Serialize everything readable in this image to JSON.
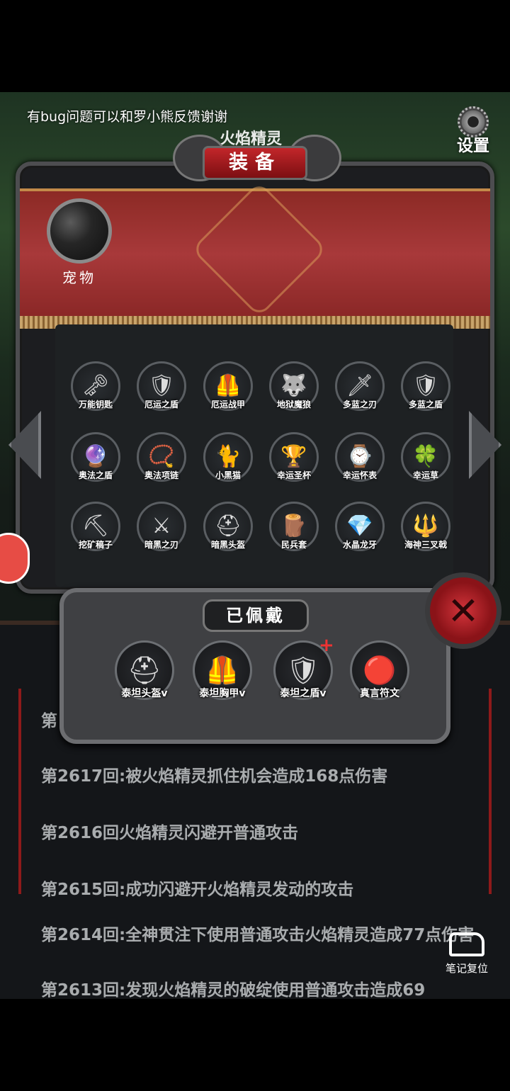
{
  "notice": "有bug问题可以和罗小熊反馈谢谢",
  "settings_label": "设置",
  "enemy_name": "火焰精灵",
  "panel_title": "装备",
  "pet_label": "宠物",
  "items": [
    {
      "name": "万能钥匙",
      "icon": "key-icon",
      "glyph": "🗝"
    },
    {
      "name": "厄运之盾",
      "icon": "red-shield-icon",
      "glyph": "🛡"
    },
    {
      "name": "厄运战甲",
      "icon": "red-armor-icon",
      "glyph": "🦺"
    },
    {
      "name": "地狱魔狼",
      "icon": "wolf-icon",
      "glyph": "🐺"
    },
    {
      "name": "多蓝之刃",
      "icon": "blade-icon",
      "glyph": "🗡"
    },
    {
      "name": "多蓝之盾",
      "icon": "round-shield-icon",
      "glyph": "🛡"
    },
    {
      "name": "奥法之盾",
      "icon": "arcane-shield-icon",
      "glyph": "🔮"
    },
    {
      "name": "奥法项链",
      "icon": "necklace-icon",
      "glyph": "📿"
    },
    {
      "name": "小黑猫",
      "icon": "cat-icon",
      "glyph": "🐈"
    },
    {
      "name": "幸运圣杯",
      "icon": "chalice-icon",
      "glyph": "🏆"
    },
    {
      "name": "幸运怀表",
      "icon": "pocket-watch-icon",
      "glyph": "⌚"
    },
    {
      "name": "幸运草",
      "icon": "clover-icon",
      "glyph": "🍀"
    },
    {
      "name": "挖矿稿子",
      "icon": "pickaxe-icon",
      "glyph": "⛏"
    },
    {
      "name": "暗黑之刃",
      "icon": "dark-blade-icon",
      "glyph": "⚔"
    },
    {
      "name": "暗黑头盔",
      "icon": "dark-helmet-icon",
      "glyph": "⛑"
    },
    {
      "name": "民兵套",
      "icon": "militia-set-icon",
      "glyph": "🪵"
    },
    {
      "name": "水晶龙牙",
      "icon": "crystal-fang-icon",
      "glyph": "💎"
    },
    {
      "name": "海神三叉戟",
      "icon": "trident-icon",
      "glyph": "🔱"
    }
  ],
  "equipped_title": "已佩戴",
  "equipped": [
    {
      "name": "泰坦头盔v",
      "icon": "titan-helmet-icon",
      "glyph": "⛑",
      "plus": ""
    },
    {
      "name": "泰坦胸甲v",
      "icon": "titan-chestplate-icon",
      "glyph": "🦺",
      "plus": ""
    },
    {
      "name": "泰坦之盾v",
      "icon": "titan-shield-icon",
      "glyph": "🛡",
      "plus": "+"
    },
    {
      "name": "真言符文",
      "icon": "rune-icon",
      "glyph": "🔴",
      "plus": ""
    }
  ],
  "log_partial_top": "第",
  "log": [
    "第2617回:被火焰精灵抓住机会造成168点伤害",
    "第2616回火焰精灵闪避开普通攻击",
    "第2615回:成功闪避开火焰精灵发动的攻击",
    "第2614回:全神贯注下使用普通攻击火焰精灵造成77点伤害",
    "第2613回:发现火焰精灵的破绽使用普通攻击造成69"
  ],
  "reset_label": "笔记复位",
  "colors": {
    "accent_red": "#c2262a",
    "banner": "#a8393a",
    "log_text": "#a9acae"
  }
}
